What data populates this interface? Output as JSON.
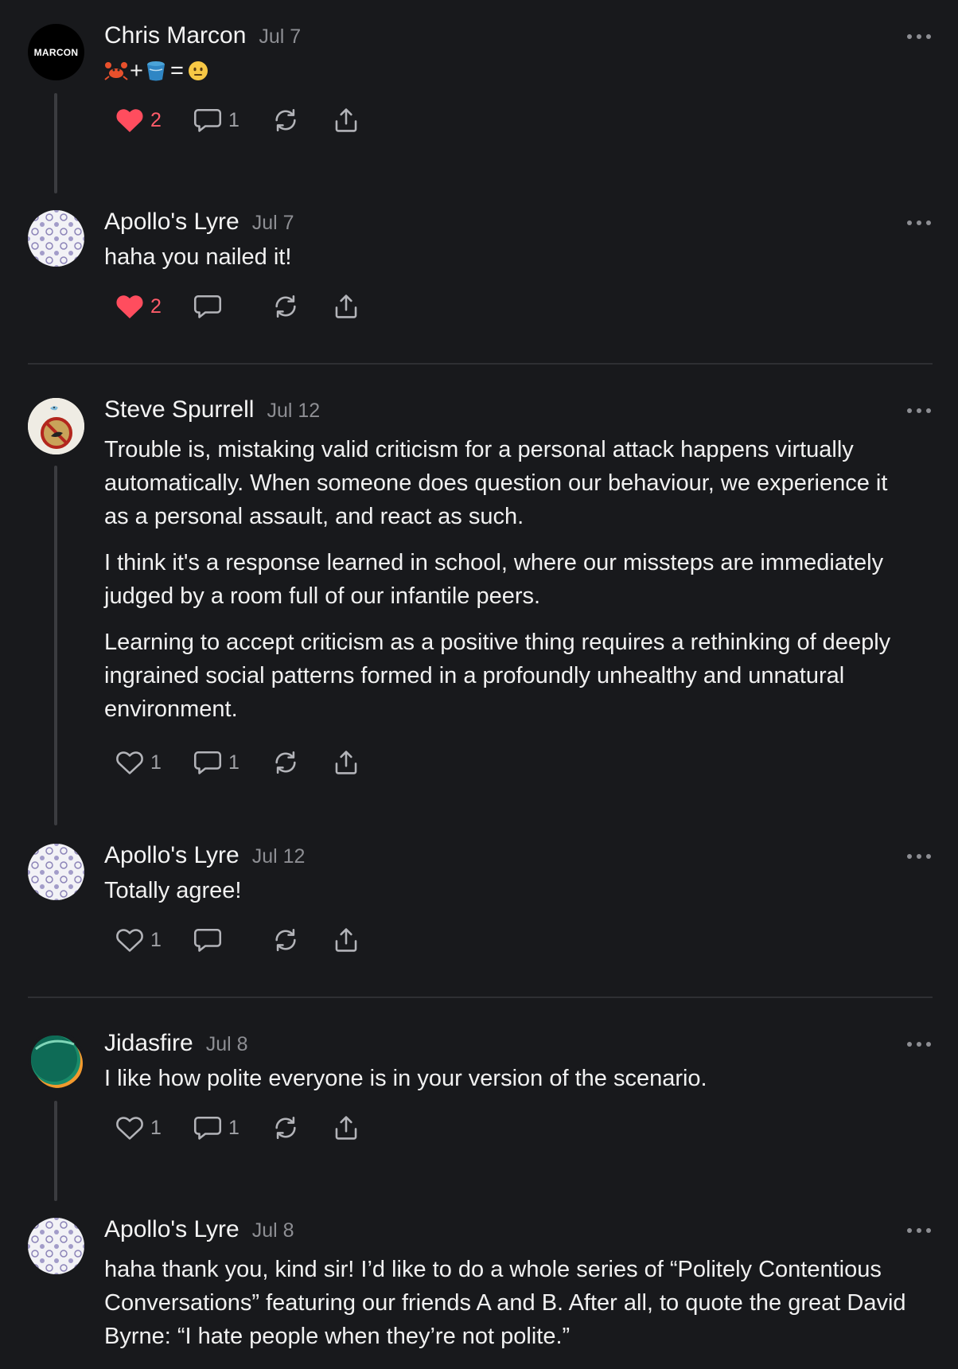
{
  "posts": [
    {
      "author": "Chris Marcon",
      "date": "Jul 7",
      "avatar_text": "MARCON",
      "paragraphs": [],
      "emoji": {
        "plus": "+",
        "equals": "="
      },
      "likes": "2",
      "replies": "1",
      "liked": true
    },
    {
      "author": "Apollo's Lyre",
      "date": "Jul 7",
      "paragraphs": [
        "haha you nailed it!"
      ],
      "likes": "2",
      "replies": "",
      "liked": true
    },
    {
      "author": "Steve Spurrell",
      "date": "Jul 12",
      "paragraphs": [
        "Trouble is, mistaking valid criticism for a personal attack happens virtually automatically. When someone does question our behaviour, we experience it as a personal assault, and react as such.",
        "I think it's a response learned in school, where our missteps are immediately judged by a room full of our infantile peers.",
        "Learning to accept criticism as a positive thing requires a rethinking of deeply ingrained social patterns formed in a profoundly unhealthy and unnatural environment."
      ],
      "likes": "1",
      "replies": "1",
      "liked": false
    },
    {
      "author": "Apollo's Lyre",
      "date": "Jul 12",
      "paragraphs": [
        "Totally agree!"
      ],
      "likes": "1",
      "replies": "",
      "liked": false
    },
    {
      "author": "Jidasfire",
      "date": "Jul 8",
      "paragraphs": [
        "I like how polite everyone is in your version of the scenario."
      ],
      "likes": "1",
      "replies": "1",
      "liked": false
    },
    {
      "author": "Apollo's Lyre",
      "date": "Jul 8",
      "paragraphs": [
        "haha thank you, kind sir! I’d like to do a whole series of “Politely Contentious Conversations” featuring our friends A and B. After all, to quote the great David Byrne: “I hate people when they’re not polite.”"
      ],
      "likes": "",
      "replies": "",
      "liked": false
    }
  ],
  "colors": {
    "background": "#18191c",
    "like_active": "#ff4d5e",
    "muted": "#8d8e93"
  }
}
